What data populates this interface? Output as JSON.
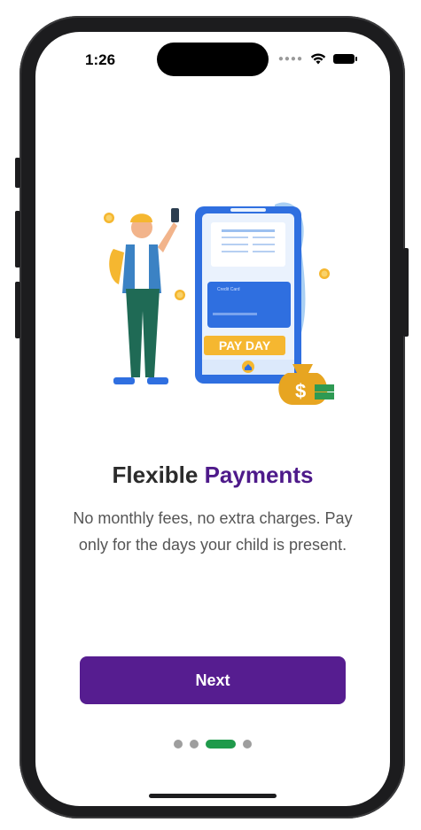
{
  "status_bar": {
    "time": "1:26",
    "signal_icon": "cellular-dots-icon",
    "wifi_icon": "wifi-icon",
    "battery_icon": "battery-icon"
  },
  "illustration": {
    "icon": "person-paying-on-phone-illustration",
    "card_text": "Credit Card",
    "banner_text": "PAY DAY"
  },
  "onboarding": {
    "title_plain": "Flexible ",
    "title_accent": "Payments",
    "subtitle": "No monthly fees, no extra charges. Pay only for the days your child is present.",
    "next_label": "Next"
  },
  "pager": {
    "total": 4,
    "active_index": 2
  },
  "colors": {
    "accent_purple": "#4e1a8a",
    "button_purple": "#561d90",
    "active_dot": "#1f9a4b",
    "inactive_dot": "#9e9e9e"
  }
}
